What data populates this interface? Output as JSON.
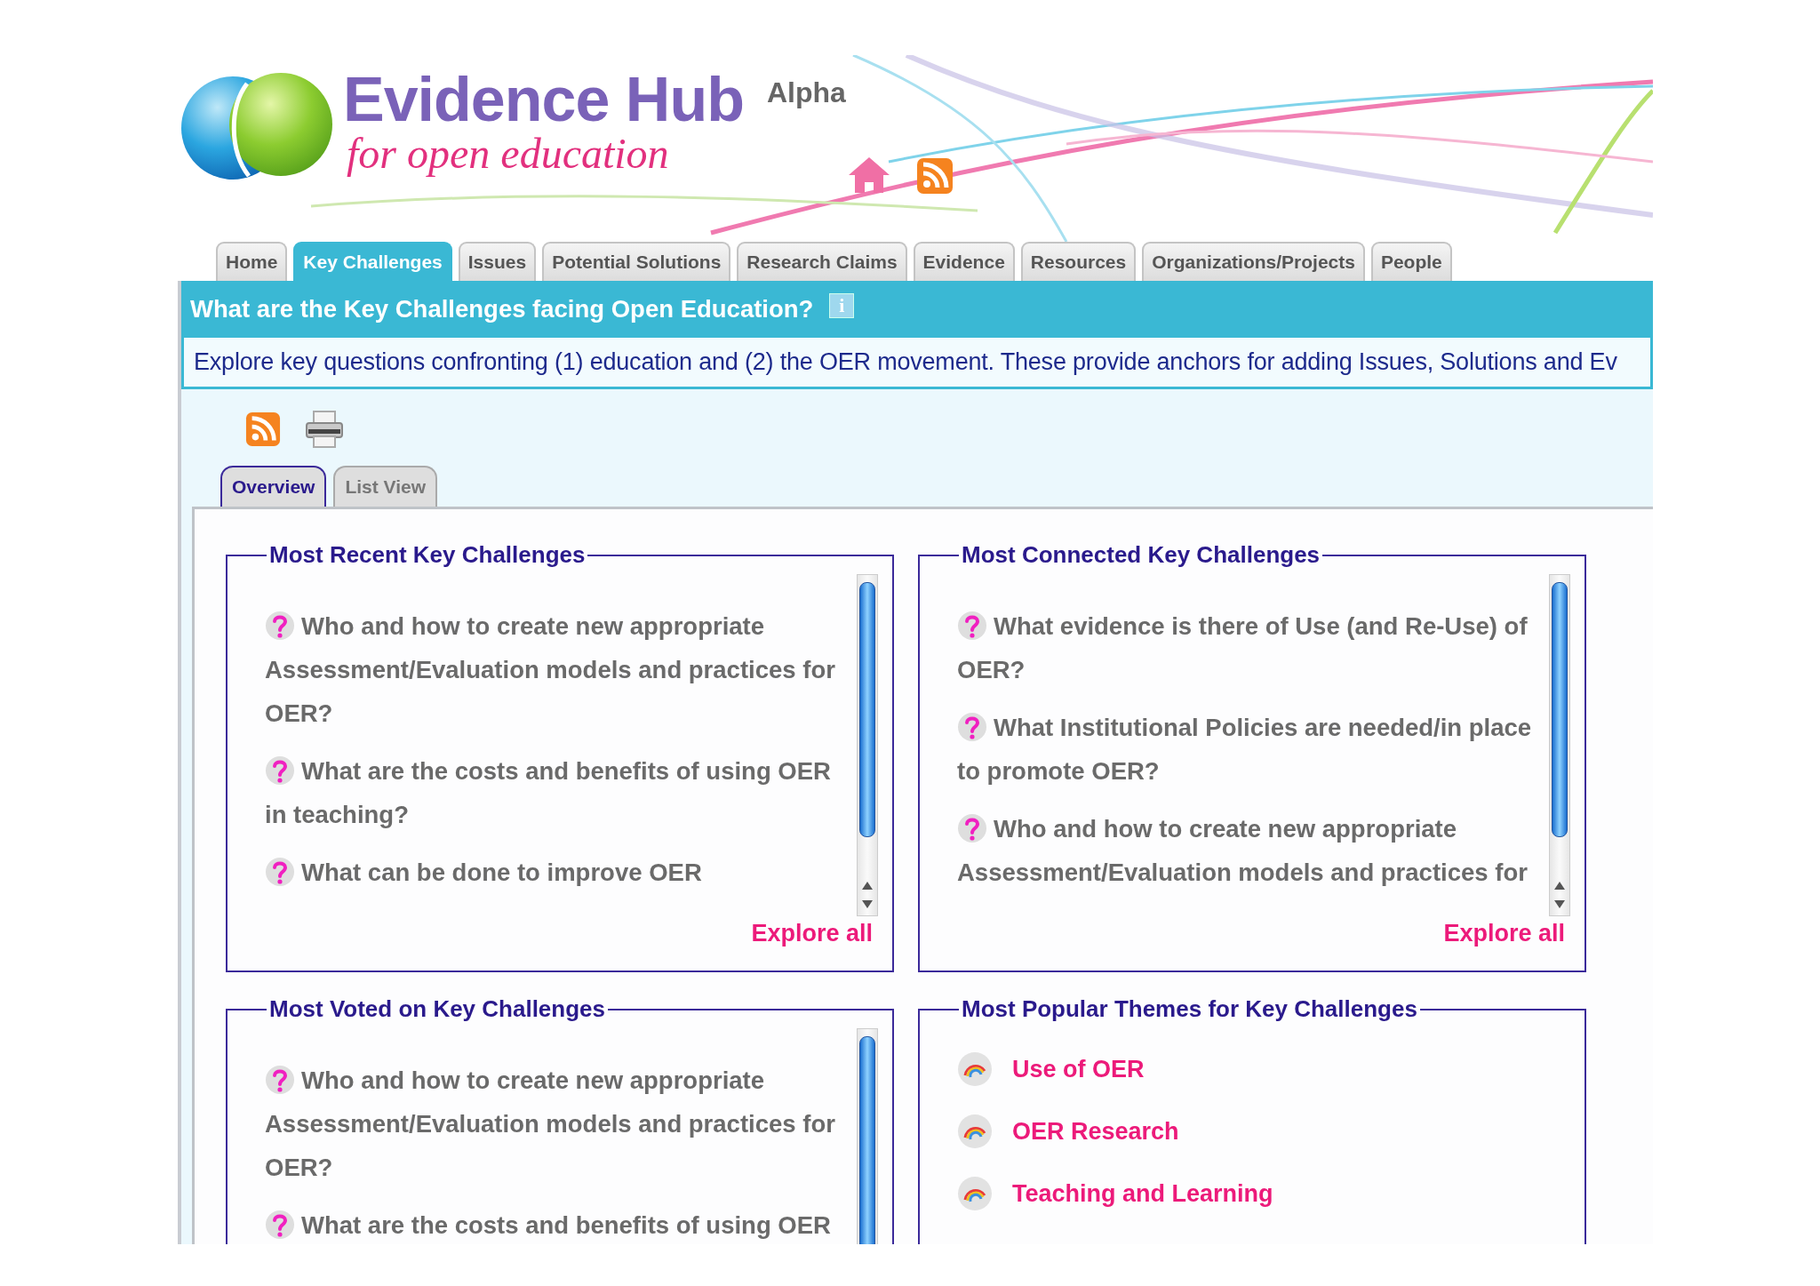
{
  "header": {
    "title": "Evidence Hub",
    "subtitle": "for open education",
    "badge": "Alpha"
  },
  "nav_tabs": [
    {
      "label": "Home",
      "selected": false
    },
    {
      "label": "Key Challenges",
      "selected": true
    },
    {
      "label": "Issues",
      "selected": false
    },
    {
      "label": "Potential Solutions",
      "selected": false
    },
    {
      "label": "Research Claims",
      "selected": false
    },
    {
      "label": "Evidence",
      "selected": false
    },
    {
      "label": "Resources",
      "selected": false
    },
    {
      "label": "Organizations/Projects",
      "selected": false
    },
    {
      "label": "People",
      "selected": false
    }
  ],
  "page_heading": {
    "title": "What are the Key Challenges facing Open Education?",
    "info_button": "i"
  },
  "description": "Explore key questions confronting (1) education and (2) the OER movement. These provide anchors for adding Issues, Solutions and Ev",
  "view_tabs": [
    {
      "label": "Overview",
      "selected": true
    },
    {
      "label": "List View",
      "selected": false
    }
  ],
  "panels": [
    {
      "kind": "challenges",
      "title": "Most Recent Key Challenges",
      "items": [
        "Who and how to create new appropriate Assessment/Evaluation models and practices for OER?",
        "What are the costs and benefits of using OER in teaching?",
        "What can be done to improve OER"
      ],
      "link": "Explore all"
    },
    {
      "kind": "challenges",
      "title": "Most Connected Key Challenges",
      "items": [
        "What evidence is there of Use (and Re-Use) of OER?",
        "What Institutional Policies are needed/in place to promote OER?",
        "Who and how to create new appropriate Assessment/Evaluation models and practices for"
      ],
      "link": "Explore all"
    },
    {
      "kind": "challenges",
      "title": "Most Voted on Key Challenges",
      "items": [
        "Who and how to create new appropriate Assessment/Evaluation models and practices for OER?",
        "What are the costs and benefits of using OER"
      ]
    },
    {
      "kind": "themes",
      "title": "Most Popular Themes for Key Challenges",
      "items": [
        "Use of OER",
        "OER Research",
        "Teaching and Learning"
      ]
    }
  ]
}
